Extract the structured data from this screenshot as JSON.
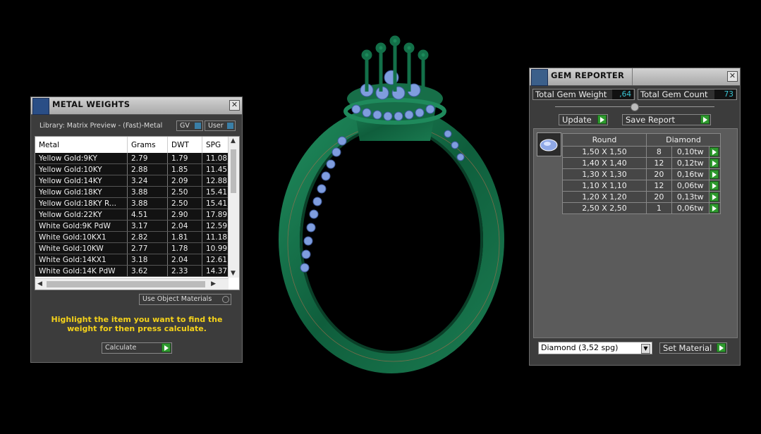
{
  "metal_weights": {
    "title": "METAL WEIGHTS",
    "library": "Library: Matrix Preview - (Fast)-Metal",
    "gv_label": "GV",
    "user_label": "User",
    "columns": [
      "Metal",
      "Grams",
      "DWT",
      "SPG"
    ],
    "rows": [
      [
        "Yellow Gold:9KY",
        "2.79",
        "1.79",
        "11.08"
      ],
      [
        "Yellow Gold:10KY",
        "2.88",
        "1.85",
        "11.45"
      ],
      [
        "Yellow Gold:14KY",
        "3.24",
        "2.09",
        "12.88"
      ],
      [
        "Yellow Gold:18KY",
        "3.88",
        "2.50",
        "15.41"
      ],
      [
        "Yellow Gold:18KY R...",
        "3.88",
        "2.50",
        "15.41"
      ],
      [
        "Yellow Gold:22KY",
        "4.51",
        "2.90",
        "17.89"
      ],
      [
        "White Gold:9K PdW",
        "3.17",
        "2.04",
        "12.59"
      ],
      [
        "White Gold:10KX1",
        "2.82",
        "1.81",
        "11.18"
      ],
      [
        "White Gold:10KW",
        "2.77",
        "1.78",
        "10.99"
      ],
      [
        "White Gold:14KX1",
        "3.18",
        "2.04",
        "12.61"
      ],
      [
        "White Gold:14K PdW",
        "3.62",
        "2.33",
        "14.37"
      ]
    ],
    "use_object_materials": "Use Object Materials",
    "hint": "Highlight the item you want to find the weight for then press calculate.",
    "calculate_label": "Calculate",
    "accent_color": "#f5d21a"
  },
  "gem_reporter": {
    "title": "GEM REPORTER",
    "total_weight_label": "Total Gem Weight",
    "total_weight_value": ",64",
    "total_count_label": "Total Gem Count",
    "total_count_value": "73",
    "update_label": "Update",
    "save_report_label": "Save Report",
    "columns": [
      "Round",
      "Diamond"
    ],
    "rows": [
      [
        "1,50 X 1,50",
        "8",
        "0,10tw"
      ],
      [
        "1,40 X 1,40",
        "12",
        "0,12tw"
      ],
      [
        "1,30 X 1,30",
        "20",
        "0,16tw"
      ],
      [
        "1,10 X 1,10",
        "12",
        "0,06tw"
      ],
      [
        "1,20 X 1,20",
        "20",
        "0,13tw"
      ],
      [
        "2,50 X 2,50",
        "1",
        "0,06tw"
      ]
    ],
    "material_select": "Diamond    (3,52 spg)",
    "set_material_label": "Set Material",
    "value_color": "#39c7d6"
  },
  "viewport": {
    "ring_metal_color": "#12704a",
    "gem_color": "#7f9dde"
  }
}
